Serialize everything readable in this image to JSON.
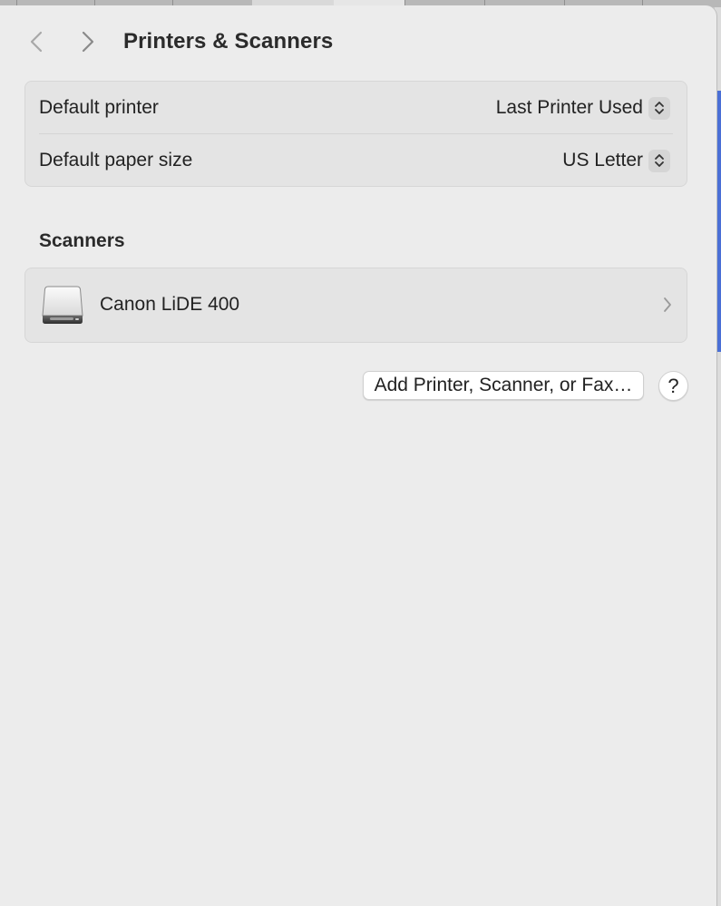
{
  "window": {
    "title": "Printers & Scanners"
  },
  "toolbar": {
    "back_icon": "chevron-left-icon",
    "forward_icon": "chevron-right-icon"
  },
  "defaults": {
    "printer_label": "Default printer",
    "printer_value": "Last Printer Used",
    "paper_label": "Default paper size",
    "paper_value": "US Letter",
    "stepper_icon": "up-down-chevron-icon"
  },
  "scanners": {
    "section_title": "Scanners",
    "items": [
      {
        "name": "Canon LiDE 400",
        "icon": "scanner-icon",
        "disclosure_icon": "chevron-right-icon"
      }
    ]
  },
  "actions": {
    "add_label": "Add Printer, Scanner, or Fax…",
    "help_label": "?"
  },
  "colors": {
    "window_background": "#ececec",
    "group_background": "#e4e4e4",
    "accent": "#4a6fd6"
  }
}
